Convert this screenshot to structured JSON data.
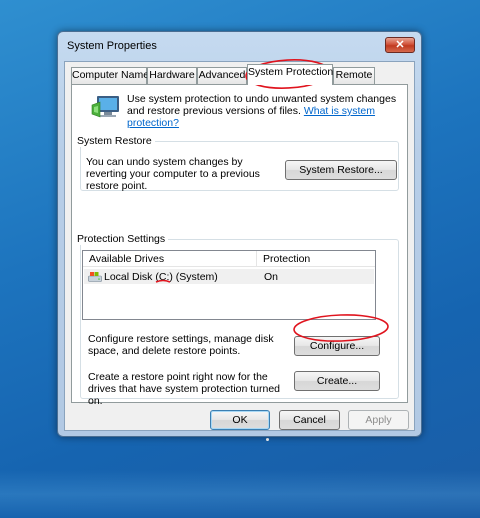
{
  "window": {
    "title": "System Properties",
    "close_label": "✕"
  },
  "tabs": [
    {
      "label": "Computer Name",
      "active": false
    },
    {
      "label": "Hardware",
      "active": false
    },
    {
      "label": "Advanced",
      "active": false
    },
    {
      "label": "System Protection",
      "active": true
    },
    {
      "label": "Remote",
      "active": false
    }
  ],
  "intro": {
    "text": "Use system protection to undo unwanted system changes and restore previous versions of files. ",
    "link": "What is system protection?"
  },
  "system_restore": {
    "label": "System Restore",
    "description": "You can undo system changes by reverting your computer to a previous restore point.",
    "button": "System Restore..."
  },
  "protection_settings": {
    "label": "Protection Settings",
    "columns": [
      "Available Drives",
      "Protection"
    ],
    "rows": [
      {
        "drive_prefix": "Local Disk ",
        "drive_letter": "(C:)",
        "drive_suffix": " (System)",
        "protection": "On"
      }
    ],
    "configure_text": "Configure restore settings, manage disk space, and delete restore points.",
    "configure_button": "Configure...",
    "create_text": "Create a restore point right now for the drives that have system protection turned on.",
    "create_button": "Create..."
  },
  "footer": {
    "ok": "OK",
    "cancel": "Cancel",
    "apply": "Apply"
  },
  "colors": {
    "desktop": "#1d74be",
    "annotation": "#e0141e",
    "link": "#0066cc"
  }
}
